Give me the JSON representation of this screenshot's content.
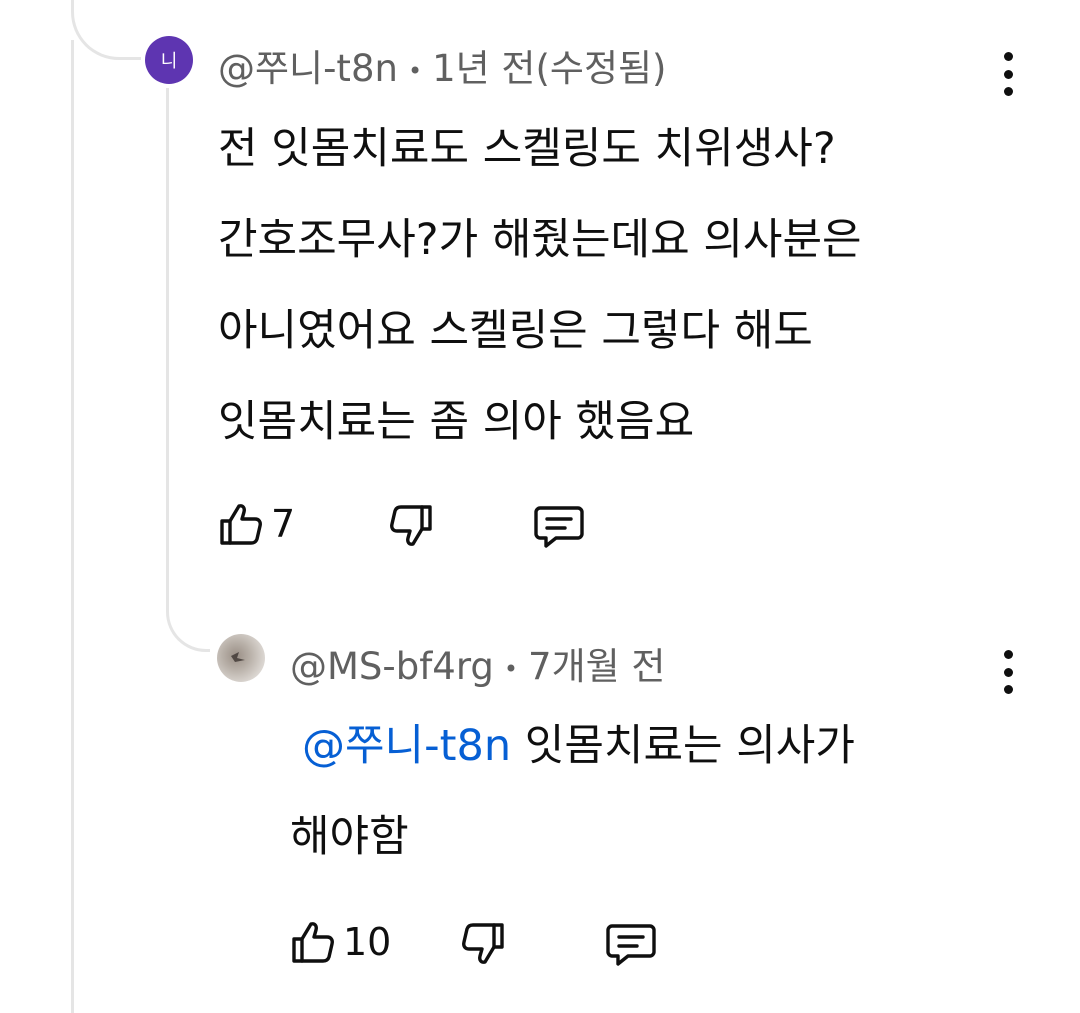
{
  "comment": {
    "avatar_initial": "니",
    "author": "@쭈니-t8n",
    "separator": "•",
    "time": "1년 전(수정됨)",
    "lines": [
      "전 잇몸치료도 스켈링도 치위생사?",
      "간호조무사?가 해줬는데요 의사분은",
      "아니였어요 스켈링은 그렇다 해도",
      "잇몸치료는 좀 의아 했음요"
    ],
    "like_count": "7",
    "icons": [
      "thumb-up-icon",
      "thumb-down-icon",
      "reply-icon",
      "more-vert-icon"
    ]
  },
  "reply": {
    "author": "@MS-bf4rg",
    "separator": "•",
    "time": "7개월 전",
    "mention": "@쭈니-t8n",
    "line1_rest": "잇몸치료는 의사가",
    "line2": "해야함",
    "like_count": "10",
    "icons": [
      "thumb-up-icon",
      "thumb-down-icon",
      "reply-icon",
      "more-vert-icon"
    ]
  },
  "colors": {
    "avatar_bg": "#5e35b1",
    "meta_text": "#606060",
    "mention": "#065fd4",
    "thread_line": "#e5e5e5"
  }
}
